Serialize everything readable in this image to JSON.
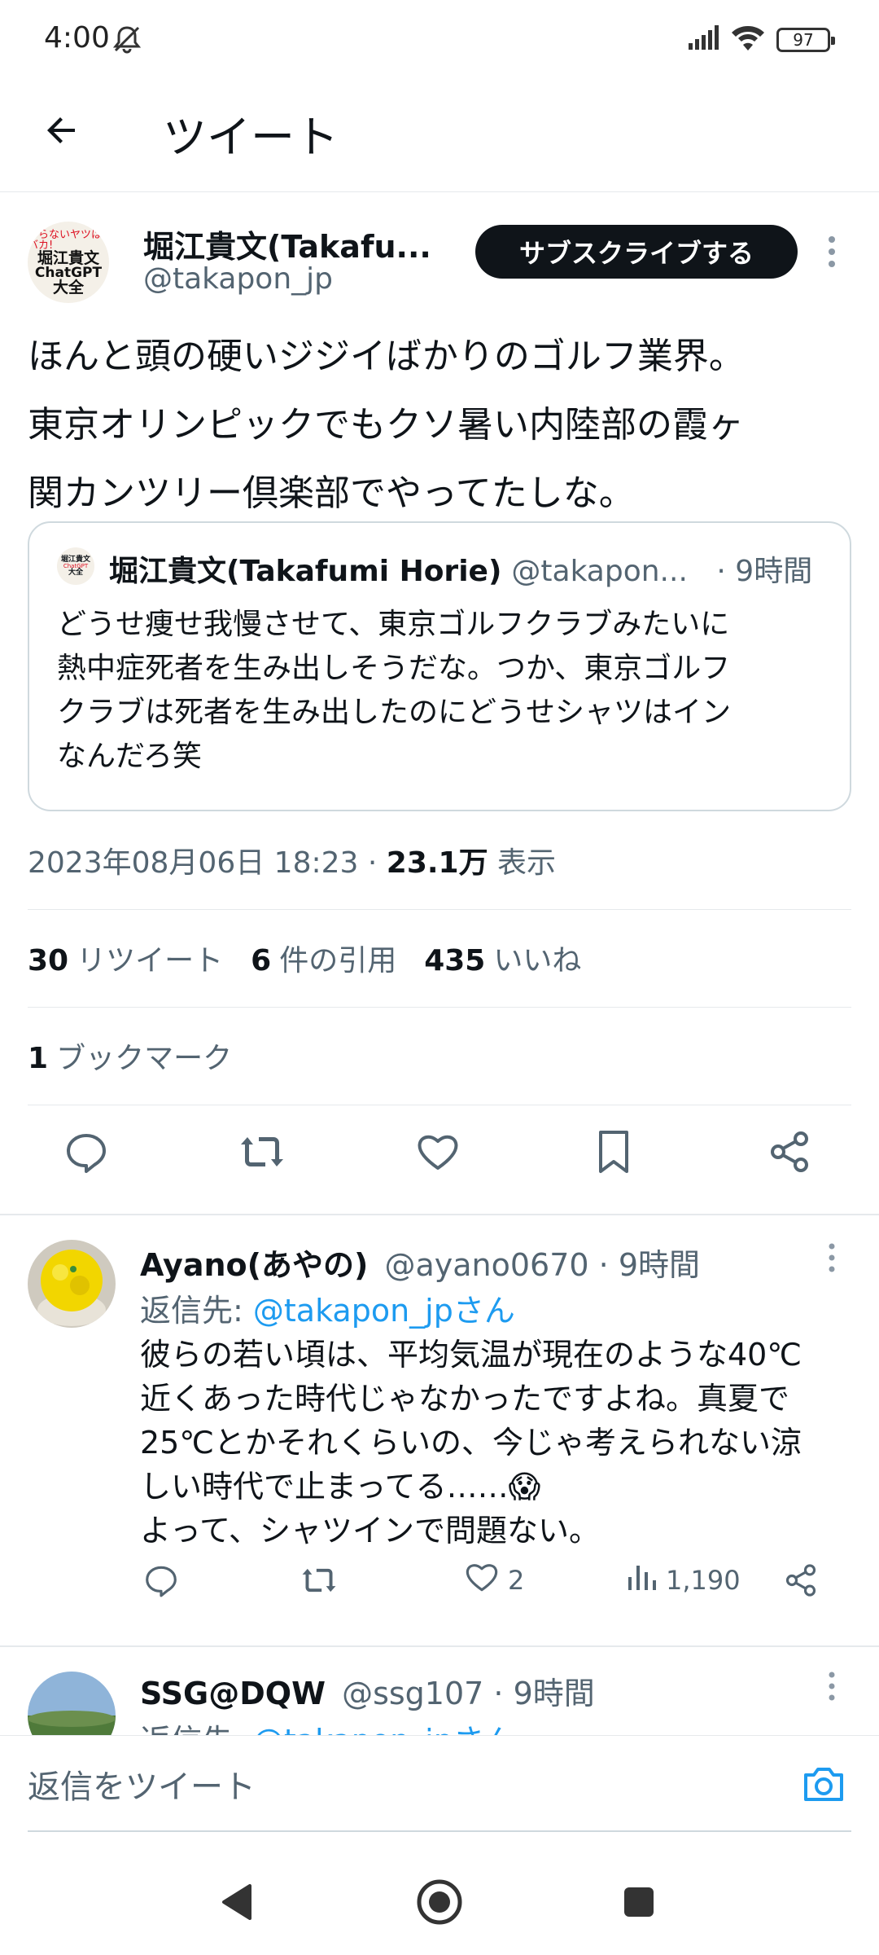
{
  "status_bar": {
    "time": "4:00",
    "battery": "97",
    "icons": [
      "do-not-disturb-icon",
      "signal-icon",
      "wifi-icon",
      "battery-icon"
    ]
  },
  "header": {
    "title": "ツイート",
    "back_icon": "back-arrow-icon"
  },
  "tweet": {
    "author_name": "堀江貴文(Takafu...",
    "author_handle": "@takapon_jp",
    "avatar_text": [
      "やらないヤツはバカ!",
      "堀江貴文",
      "ChatGPT",
      "大全"
    ],
    "subscribe_label": "サブスクライブする",
    "text_lines": [
      "ほんと頭の硬いジジイばかりのゴルフ業界。",
      "東京オリンピックでもクソ暑い内陸部の霞ヶ",
      "関カンツリー倶楽部でやってたしな。"
    ],
    "quote": {
      "name": "堀江貴文(Takafumi Horie)",
      "handle": "@takapon...",
      "time": "· 9時間",
      "avatar_text": [
        "堀江貴文",
        "ChatGPT",
        "大全"
      ],
      "text_lines": [
        "どうせ痩せ我慢させて、東京ゴルフクラブみたいに",
        "熱中症死者を生み出しそうだな。つか、東京ゴルフ",
        "クラブは死者を生み出したのにどうせシャツはイン",
        "なんだろ笑"
      ]
    },
    "date": "2023年08月06日 18:23 · ",
    "views_count": "23.1万",
    "views_label": " 表示",
    "retweets_count": "30",
    "retweets_label": "リツイート",
    "quotes_count": "6",
    "quotes_label": "件の引用",
    "likes_count": "435",
    "likes_label": "いいね",
    "bookmarks_count": "1",
    "bookmarks_label": "ブックマーク"
  },
  "replies": [
    {
      "name": "Ayano(あやの)",
      "handle": "@ayano0670",
      "time": " · 9時間",
      "reply_to_prefix": "返信先: ",
      "reply_to_mention": "@takapon_jpさん",
      "text_lines": [
        "彼らの若い頃は、平均気温が現在のような40℃",
        "近くあった時代じゃなかったですよね。真夏で",
        "25℃とかそれくらいの、今じゃ考えられない涼",
        "しい時代で止まってる……😱",
        "よって、シャツインで問題ない。"
      ],
      "likes": "2",
      "views": "1,190"
    },
    {
      "name": "SSG@DQW",
      "handle": "@ssg107",
      "time": " · 9時間",
      "reply_to_prefix": "返信先: ",
      "reply_to_mention": "@takapon_jpさん"
    }
  ],
  "reply_bar": {
    "placeholder": "返信をツイート"
  },
  "colors": {
    "accent": "#1d9bf0",
    "text": "#0f1419",
    "muted": "#536471",
    "border": "#e6e9ec"
  }
}
